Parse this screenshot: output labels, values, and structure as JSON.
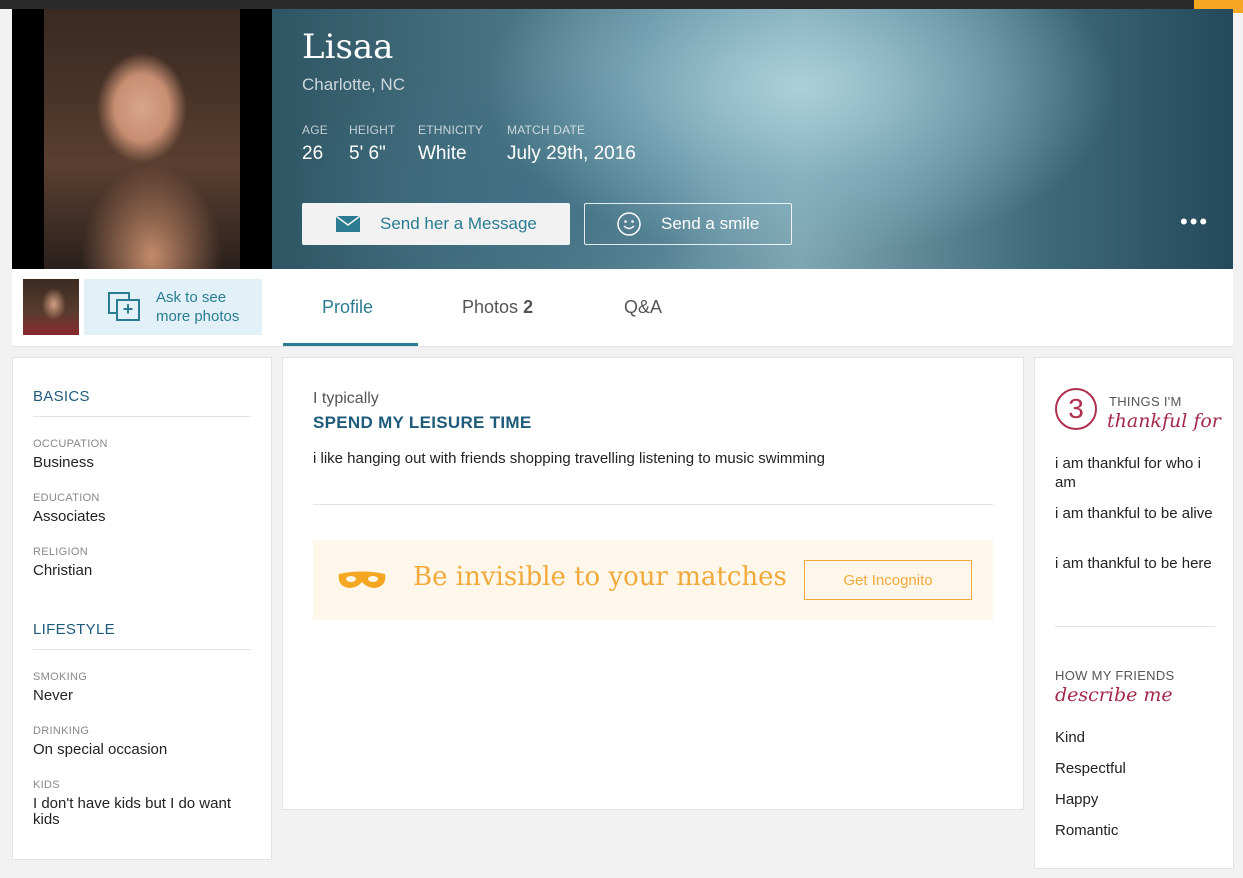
{
  "profile": {
    "name": "Lisaa",
    "location": "Charlotte, NC",
    "stats": [
      {
        "label": "AGE",
        "value": "26"
      },
      {
        "label": "HEIGHT",
        "value": "5' 6\""
      },
      {
        "label": "ETHNICITY",
        "value": "White"
      },
      {
        "label": "MATCH DATE",
        "value": "July 29th, 2016"
      }
    ],
    "message_button": "Send her a Message",
    "smile_button": "Send a smile",
    "more_button": "•••"
  },
  "tabs": {
    "ask_photos": "Ask to see more photos",
    "profile": "Profile",
    "photos_label": "Photos",
    "photos_count": "2",
    "qa": "Q&A"
  },
  "basics": {
    "title": "BASICS",
    "fields": [
      {
        "label": "OCCUPATION",
        "value": "Business"
      },
      {
        "label": "EDUCATION",
        "value": "Associates"
      },
      {
        "label": "RELIGION",
        "value": "Christian"
      }
    ]
  },
  "lifestyle": {
    "title": "LIFESTYLE",
    "fields": [
      {
        "label": "SMOKING",
        "value": "Never"
      },
      {
        "label": "DRINKING",
        "value": "On special occasion"
      },
      {
        "label": "KIDS",
        "value": "I don't have kids but I do want kids"
      }
    ]
  },
  "leisure": {
    "intro": "I typically",
    "heading": "SPEND MY LEISURE TIME",
    "text": "i like hanging out with friends shopping travelling listening to music swimming"
  },
  "incognito": {
    "text": "Be invisible to your matches",
    "button": "Get Incognito",
    "color": "#f0a93a"
  },
  "thankful": {
    "number": "3",
    "small": "THINGS I'M",
    "script": "thankful for",
    "items": [
      "i am thankful for who i am",
      "i am thankful to be alive",
      "i am thankful to be here"
    ]
  },
  "friends": {
    "small": "HOW MY FRIENDS",
    "script": "describe me",
    "items": [
      "Kind",
      "Respectful",
      "Happy",
      "Romantic"
    ]
  },
  "colors": {
    "accent": "#2b7c92",
    "heading": "#1e5a7a",
    "script": "#a42a4a"
  }
}
